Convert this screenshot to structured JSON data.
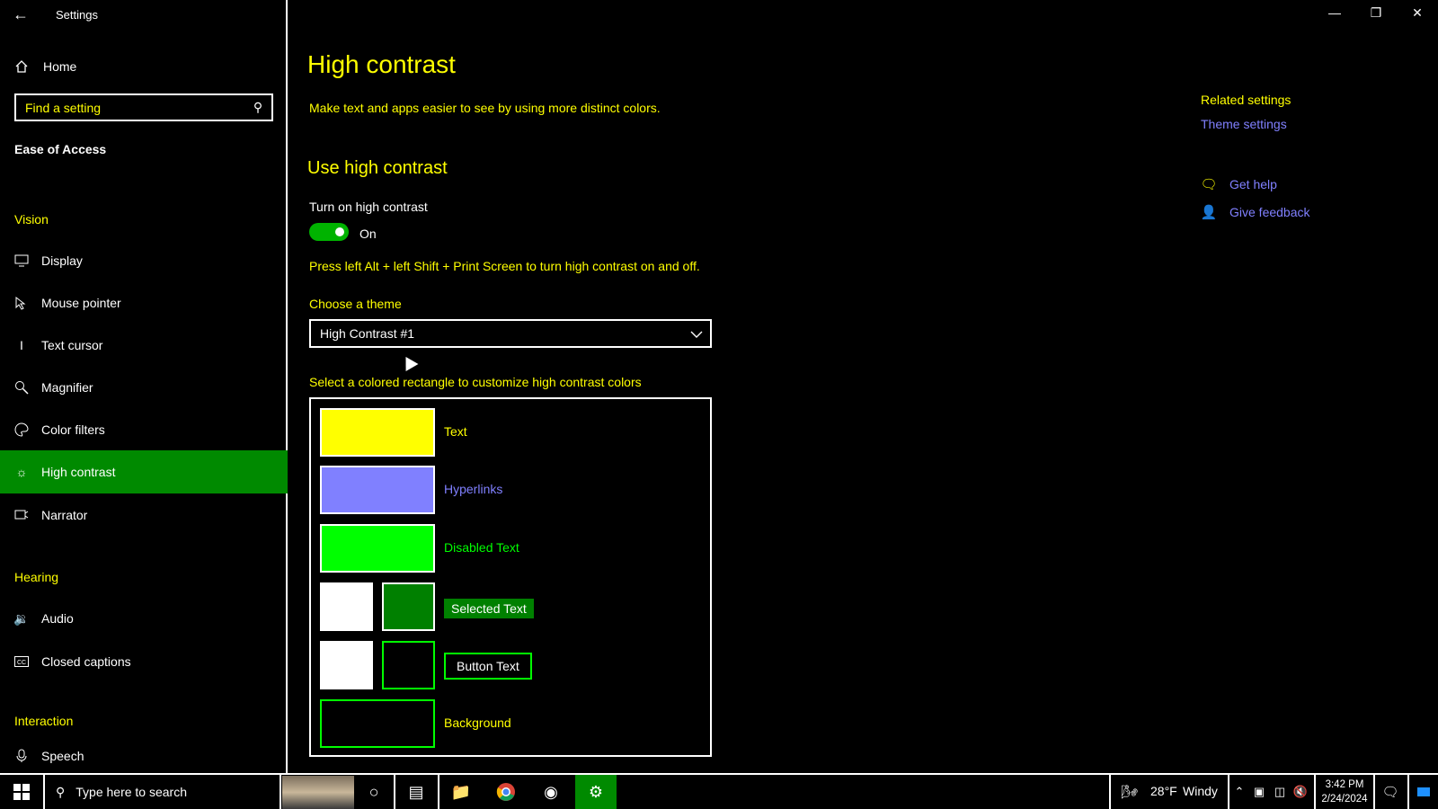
{
  "window": {
    "title": "Settings",
    "back_icon": "back-arrow-icon",
    "controls": [
      "minimize-icon",
      "restore-icon",
      "close-icon"
    ]
  },
  "sidebar": {
    "home_label": "Home",
    "search_placeholder": "Find a setting",
    "section_title": "Ease of Access",
    "groups": {
      "vision": "Vision",
      "hearing": "Hearing",
      "interaction": "Interaction"
    },
    "items": [
      {
        "label": "Display",
        "icon": "monitor-icon"
      },
      {
        "label": "Mouse pointer",
        "icon": "mouse-pointer-icon"
      },
      {
        "label": "Text cursor",
        "icon": "text-cursor-icon"
      },
      {
        "label": "Magnifier",
        "icon": "magnifier-icon"
      },
      {
        "label": "Color filters",
        "icon": "palette-icon"
      },
      {
        "label": "High contrast",
        "icon": "sun-icon",
        "active": true
      },
      {
        "label": "Narrator",
        "icon": "narrator-icon"
      },
      {
        "label": "Audio",
        "icon": "speaker-icon"
      },
      {
        "label": "Closed captions",
        "icon": "captions-icon"
      },
      {
        "label": "Speech",
        "icon": "microphone-icon"
      }
    ],
    "active_color": "#008a00"
  },
  "main": {
    "title": "High contrast",
    "description": "Make text and apps easier to see by using more distinct colors.",
    "section": "Use high contrast",
    "toggle_label": "Turn on high contrast",
    "toggle_state": "On",
    "hint": "Press left Alt + left Shift + Print Screen to turn high contrast on and off.",
    "theme_label": "Choose a theme",
    "theme_value": "High Contrast #1",
    "customize_label": "Select a colored rectangle to customize high contrast colors",
    "swatches": {
      "text": {
        "label": "Text",
        "color": "#ffff00"
      },
      "hyperlinks": {
        "label": "Hyperlinks",
        "color": "#8080ff"
      },
      "disabled": {
        "label": "Disabled Text",
        "color": "#00ff00"
      },
      "selected": {
        "label": "Selected Text",
        "fg": "#ffffff",
        "bg": "#008000"
      },
      "button": {
        "label": "Button Text",
        "fg": "#ffffff",
        "bg": "#000000"
      },
      "background": {
        "label": "Background",
        "color": "#000000"
      }
    }
  },
  "related": {
    "title": "Related settings",
    "theme_link": "Theme settings",
    "get_help": "Get help",
    "feedback": "Give feedback"
  },
  "taskbar": {
    "search_placeholder": "Type here to search",
    "weather_temp": "28°F",
    "weather_text": "Windy",
    "time": "3:42 PM",
    "date": "2/24/2024"
  }
}
